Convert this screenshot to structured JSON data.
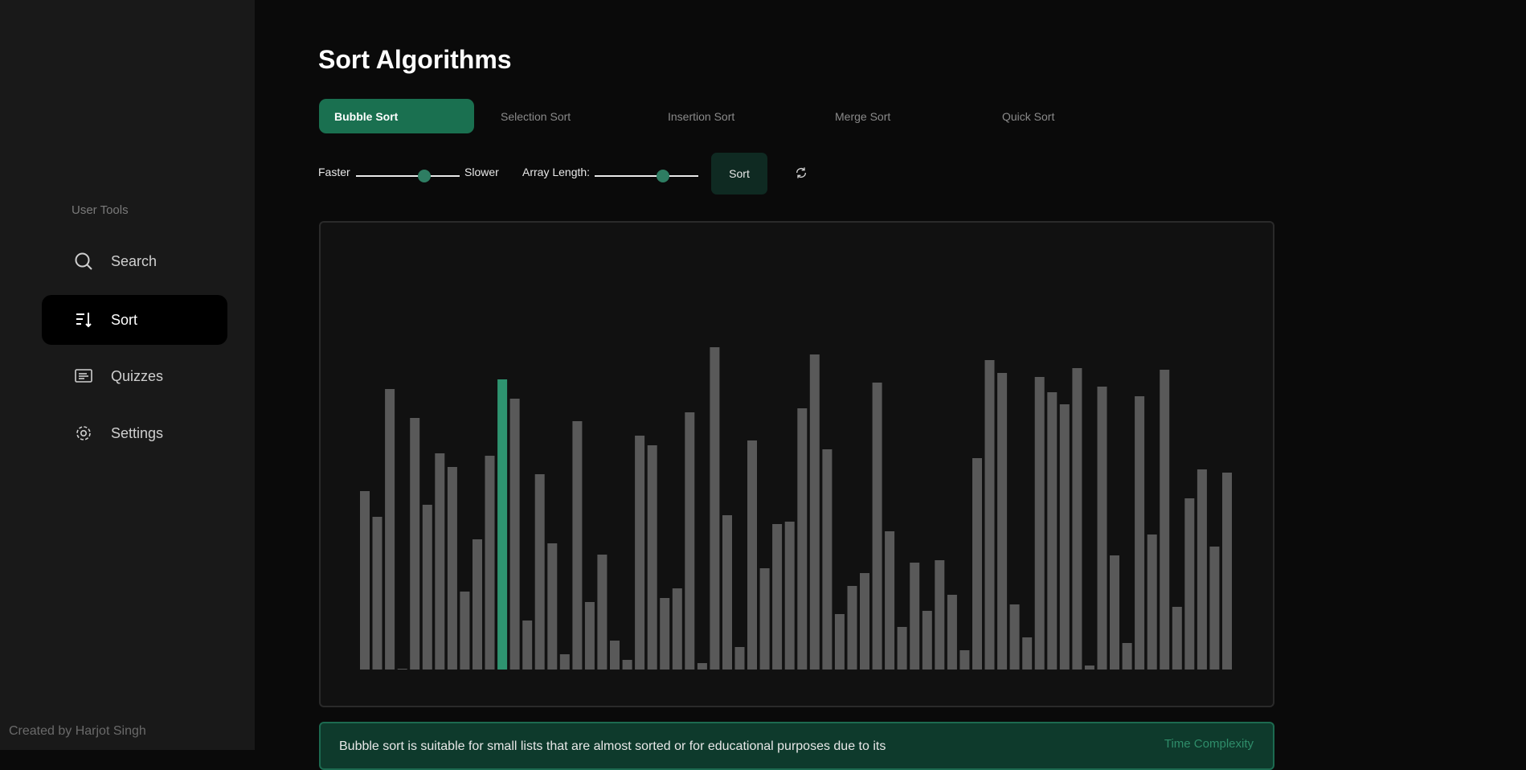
{
  "sidebar": {
    "heading": "User Tools",
    "items": [
      {
        "label": "Search",
        "icon": "search-icon"
      },
      {
        "label": "Sort",
        "icon": "sort-icon",
        "active": true
      },
      {
        "label": "Quizzes",
        "icon": "quiz-icon"
      },
      {
        "label": "Settings",
        "icon": "gear-icon"
      }
    ],
    "credit": "Created by Harjot Singh"
  },
  "main": {
    "title": "Sort Algorithms",
    "tabs": [
      {
        "label": "Bubble Sort",
        "active": true
      },
      {
        "label": "Selection Sort"
      },
      {
        "label": "Insertion Sort"
      },
      {
        "label": "Merge Sort"
      },
      {
        "label": "Quick Sort"
      }
    ],
    "controls": {
      "speed_left_label": "Faster",
      "speed_right_label": "Slower",
      "speed_level": 0.66,
      "length_label": "Array Length:",
      "length_level": 0.66,
      "sort_button": "Sort",
      "reset_icon": "refresh-icon"
    },
    "info": {
      "text": "Bubble sort is suitable for small lists that are almost sorted or for educational purposes due to its",
      "link": "Time Complexity"
    }
  },
  "colors": {
    "accent": "#1a7050",
    "bar": "#595959",
    "bar_highlight": "#2e9470"
  },
  "chart_data": {
    "type": "bar",
    "values": [
      222,
      190,
      349,
      0,
      313,
      205,
      269,
      252,
      97,
      162,
      266,
      361,
      337,
      61,
      243,
      157,
      19,
      309,
      84,
      143,
      36,
      12,
      291,
      279,
      89,
      101,
      320,
      8,
      401,
      192,
      28,
      285,
      126,
      181,
      184,
      325,
      392,
      274,
      69,
      104,
      120,
      357,
      172,
      53,
      133,
      73,
      136,
      93,
      24,
      263,
      385,
      369,
      81,
      40,
      364,
      345,
      330,
      375,
      5,
      352,
      142,
      33,
      340,
      168,
      373,
      78,
      213,
      249,
      153,
      245
    ],
    "highlight_index": 11
  }
}
